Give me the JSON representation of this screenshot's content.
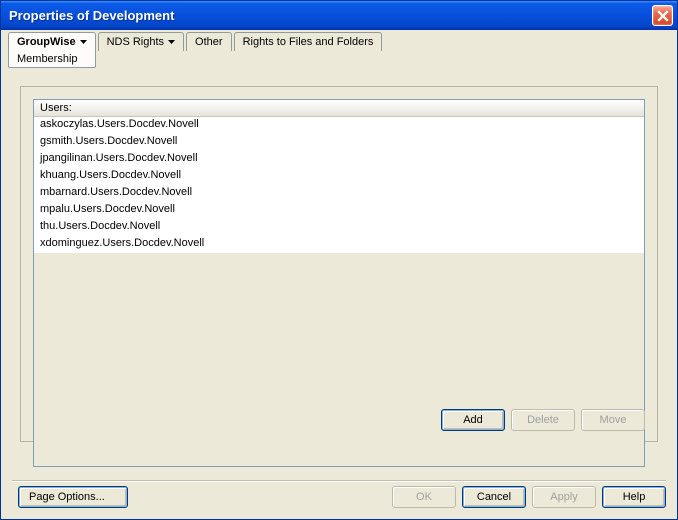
{
  "window": {
    "title": "Properties of Development"
  },
  "tabs": {
    "groupwise": "GroupWise",
    "groupwise_sub": "Membership",
    "nds_rights": "NDS Rights",
    "other": "Other",
    "rights_files": "Rights to Files and Folders"
  },
  "list": {
    "header": "Users:",
    "rows": [
      "askoczylas.Users.Docdev.Novell",
      "gsmith.Users.Docdev.Novell",
      "jpangilinan.Users.Docdev.Novell",
      "khuang.Users.Docdev.Novell",
      "mbarnard.Users.Docdev.Novell",
      "mpalu.Users.Docdev.Novell",
      "thu.Users.Docdev.Novell",
      "xdominguez.Users.Docdev.Novell"
    ]
  },
  "actions": {
    "add": "Add",
    "delete": "Delete",
    "move": "Move"
  },
  "footer": {
    "page_options": "Page Options...",
    "ok": "OK",
    "cancel": "Cancel",
    "apply": "Apply",
    "help": "Help"
  }
}
